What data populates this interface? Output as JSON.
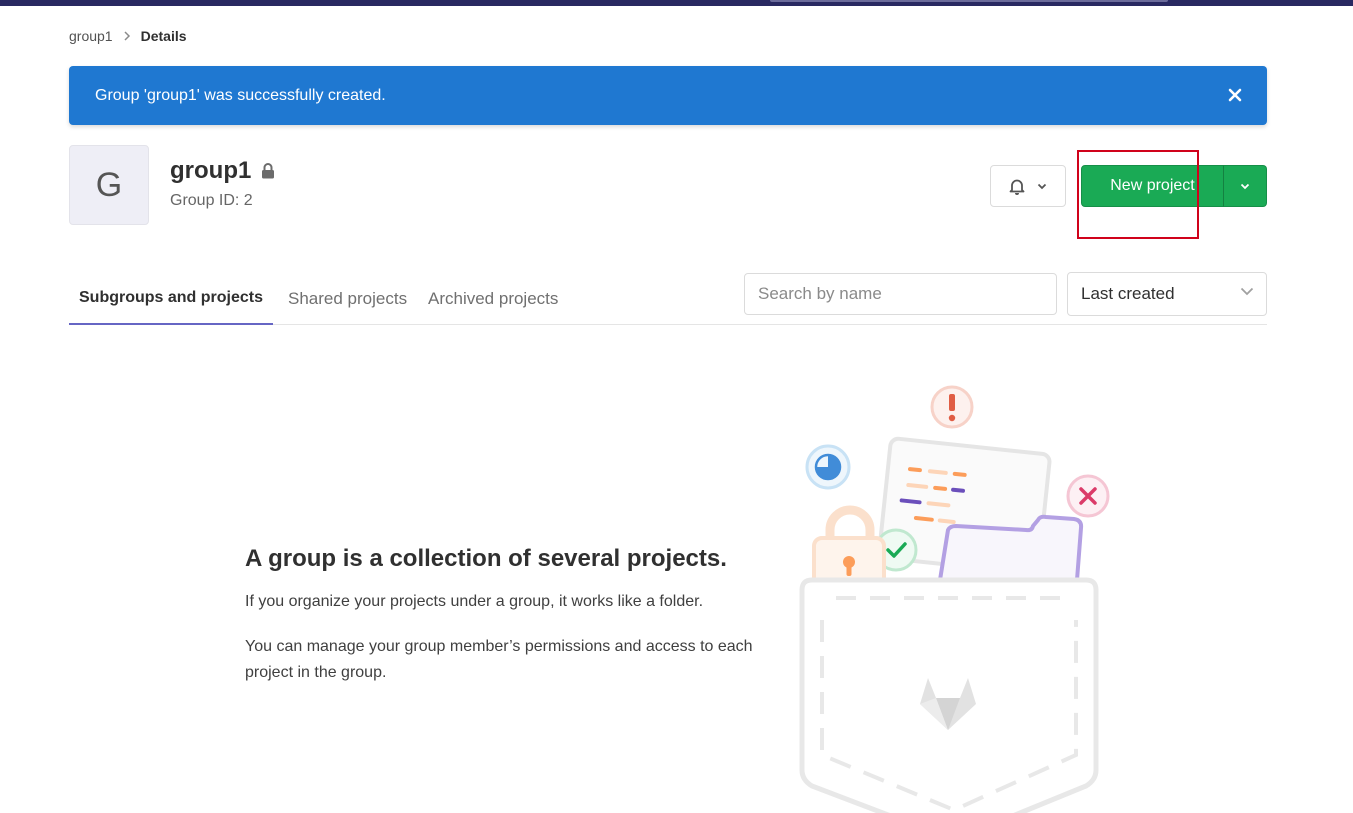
{
  "breadcrumb": {
    "group": "group1",
    "current": "Details"
  },
  "flash": {
    "message": "Group 'group1' was successfully created.",
    "close_icon": "close-icon"
  },
  "group": {
    "avatar_letter": "G",
    "name": "group1",
    "id_label": "Group ID: 2",
    "visibility_icon": "lock-icon"
  },
  "actions": {
    "notification_icon": "bell-icon",
    "new_project_label": "New project",
    "toggle_icon": "chevron-down-icon"
  },
  "tabs": [
    {
      "label": "Subgroups and projects",
      "active": true
    },
    {
      "label": "Shared projects",
      "active": false
    },
    {
      "label": "Archived projects",
      "active": false
    }
  ],
  "filters": {
    "search_placeholder": "Search by name",
    "sort_value": "Last created"
  },
  "empty_state": {
    "title": "A group is a collection of several projects.",
    "line1": "If you organize your projects under a group, it works like a folder.",
    "line2": "You can manage your group member’s permissions and access to each project in the group."
  },
  "colors": {
    "accent": "#1f78d1",
    "success": "#1aaa55",
    "topbar": "#292961",
    "highlight": "#d0021b"
  }
}
